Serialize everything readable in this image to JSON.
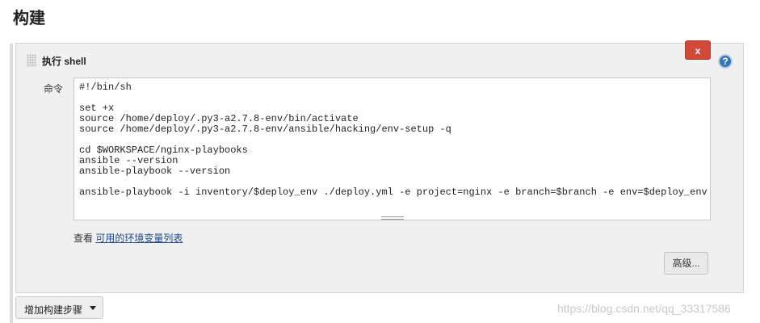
{
  "section": {
    "title": "构建"
  },
  "step": {
    "title": "执行 shell",
    "delete_label": "x",
    "help_label": "?",
    "command_label": "命令",
    "code": "#!/bin/sh\n\nset +x\nsource /home/deploy/.py3-a2.7.8-env/bin/activate\nsource /home/deploy/.py3-a2.7.8-env/ansible/hacking/env-setup -q\n\ncd $WORKSPACE/nginx-playbooks\nansible --version\nansible-playbook --version\n\nansible-playbook -i inventory/$deploy_env ./deploy.yml -e project=nginx -e branch=$branch -e env=$deploy_env",
    "env_prefix": "查看",
    "env_link": "可用的环境变量列表",
    "advanced_label": "高级..."
  },
  "add_step": {
    "label": "增加构建步骤"
  },
  "watermark": "https://blog.csdn.net/qq_33317586",
  "colors": {
    "delete": "#d24939",
    "help": "#3a74b8",
    "link": "#204a87"
  }
}
